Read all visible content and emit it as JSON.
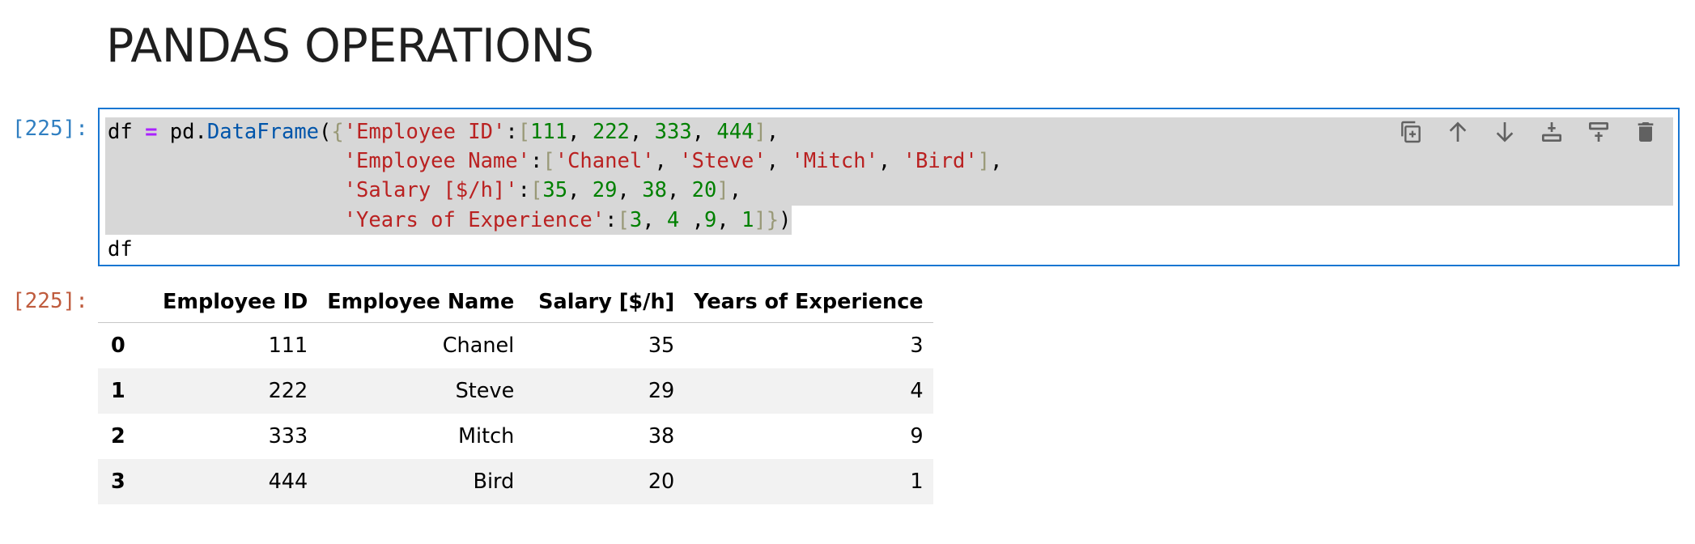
{
  "heading": "PANDAS OPERATIONS",
  "cell": {
    "in_prompt": "[225]:",
    "out_prompt": "[225]:"
  },
  "code_lines": [
    [
      {
        "t": "df",
        "c": "k-var"
      },
      {
        "t": " ",
        "c": "k-pu"
      },
      {
        "t": "=",
        "c": "k-op"
      },
      {
        "t": " pd.",
        "c": "k-pu"
      },
      {
        "t": "DataFrame",
        "c": "k-fn"
      },
      {
        "t": "(",
        "c": "k-pu"
      },
      {
        "t": "{",
        "c": "k-br"
      },
      {
        "t": "'Employee ID'",
        "c": "k-str"
      },
      {
        "t": ":",
        "c": "k-pu"
      },
      {
        "t": "[",
        "c": "k-br"
      },
      {
        "t": "111",
        "c": "k-num"
      },
      {
        "t": ", ",
        "c": "k-pu"
      },
      {
        "t": "222",
        "c": "k-num"
      },
      {
        "t": ", ",
        "c": "k-pu"
      },
      {
        "t": "333",
        "c": "k-num"
      },
      {
        "t": ", ",
        "c": "k-pu"
      },
      {
        "t": "444",
        "c": "k-num"
      },
      {
        "t": "]",
        "c": "k-br"
      },
      {
        "t": ",",
        "c": "k-pu"
      }
    ],
    [
      {
        "t": "                   ",
        "c": "k-pu"
      },
      {
        "t": "'Employee Name'",
        "c": "k-str"
      },
      {
        "t": ":",
        "c": "k-pu"
      },
      {
        "t": "[",
        "c": "k-br"
      },
      {
        "t": "'Chanel'",
        "c": "k-str"
      },
      {
        "t": ", ",
        "c": "k-pu"
      },
      {
        "t": "'Steve'",
        "c": "k-str"
      },
      {
        "t": ", ",
        "c": "k-pu"
      },
      {
        "t": "'Mitch'",
        "c": "k-str"
      },
      {
        "t": ", ",
        "c": "k-pu"
      },
      {
        "t": "'Bird'",
        "c": "k-str"
      },
      {
        "t": "]",
        "c": "k-br"
      },
      {
        "t": ",",
        "c": "k-pu"
      }
    ],
    [
      {
        "t": "                   ",
        "c": "k-pu"
      },
      {
        "t": "'Salary [$/h]'",
        "c": "k-str"
      },
      {
        "t": ":",
        "c": "k-pu"
      },
      {
        "t": "[",
        "c": "k-br"
      },
      {
        "t": "35",
        "c": "k-num"
      },
      {
        "t": ", ",
        "c": "k-pu"
      },
      {
        "t": "29",
        "c": "k-num"
      },
      {
        "t": ", ",
        "c": "k-pu"
      },
      {
        "t": "38",
        "c": "k-num"
      },
      {
        "t": ", ",
        "c": "k-pu"
      },
      {
        "t": "20",
        "c": "k-num"
      },
      {
        "t": "]",
        "c": "k-br"
      },
      {
        "t": ",",
        "c": "k-pu"
      }
    ],
    [
      {
        "t": "                   ",
        "c": "k-pu"
      },
      {
        "t": "'Years of Experience'",
        "c": "k-str"
      },
      {
        "t": ":",
        "c": "k-pu"
      },
      {
        "t": "[",
        "c": "k-br"
      },
      {
        "t": "3",
        "c": "k-num"
      },
      {
        "t": ", ",
        "c": "k-pu"
      },
      {
        "t": "4",
        "c": "k-num"
      },
      {
        "t": " ,",
        "c": "k-pu"
      },
      {
        "t": "9",
        "c": "k-num"
      },
      {
        "t": ", ",
        "c": "k-pu"
      },
      {
        "t": "1",
        "c": "k-num"
      },
      {
        "t": "]}",
        "c": "k-br"
      },
      {
        "t": ")",
        "c": "k-pu"
      }
    ],
    [
      {
        "t": "df",
        "c": "k-var"
      }
    ]
  ],
  "selected_lines": [
    0,
    1,
    2,
    3
  ],
  "toolbar_icons": [
    "duplicate-icon",
    "move-up-icon",
    "move-down-icon",
    "insert-above-icon",
    "insert-below-icon",
    "delete-icon"
  ],
  "table": {
    "columns": [
      "Employee ID",
      "Employee Name",
      "Salary [$/h]",
      "Years of Experience"
    ],
    "rows": [
      {
        "index": "0",
        "cells": [
          "111",
          "Chanel",
          "35",
          "3"
        ]
      },
      {
        "index": "1",
        "cells": [
          "222",
          "Steve",
          "29",
          "4"
        ]
      },
      {
        "index": "2",
        "cells": [
          "333",
          "Mitch",
          "38",
          "9"
        ]
      },
      {
        "index": "3",
        "cells": [
          "444",
          "Bird",
          "20",
          "1"
        ]
      }
    ]
  }
}
